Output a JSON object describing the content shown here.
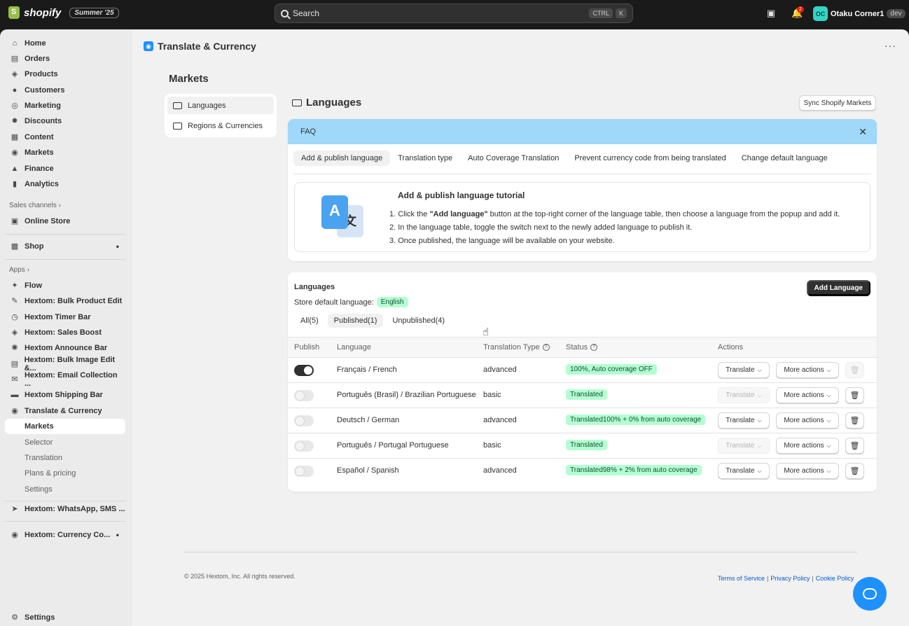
{
  "topbar": {
    "brand": "shopify",
    "edition_badge": "Summer '25",
    "search_placeholder": "Search",
    "shortcut_keys": [
      "CTRL",
      "K"
    ],
    "notification_count": "2",
    "user_initials": "OC",
    "store_name": "Otaku Corner1",
    "env_badge": "dev"
  },
  "sidebar": {
    "main_items": [
      {
        "label": "Home",
        "icon": "home-icon"
      },
      {
        "label": "Orders",
        "icon": "inbox-icon"
      },
      {
        "label": "Products",
        "icon": "tag-icon"
      },
      {
        "label": "Customers",
        "icon": "person-icon"
      },
      {
        "label": "Marketing",
        "icon": "target-icon"
      },
      {
        "label": "Discounts",
        "icon": "discount-icon"
      },
      {
        "label": "Content",
        "icon": "content-icon"
      },
      {
        "label": "Markets",
        "icon": "globe-icon"
      },
      {
        "label": "Finance",
        "icon": "bank-icon"
      },
      {
        "label": "Analytics",
        "icon": "chart-icon"
      }
    ],
    "sales_channels_label": "Sales channels",
    "online_store": "Online Store",
    "shop": "Shop",
    "apps_label": "Apps",
    "apps": [
      "Flow",
      "Hextom: Bulk Product Edit",
      "Hextom Timer Bar",
      "Hextom: Sales Boost",
      "Hextom Announce Bar",
      "Hextom: Bulk Image Edit &...",
      "Hextom: Email Collection ...",
      "Hextom Shipping Bar",
      "Translate & Currency"
    ],
    "app_subitems": [
      "Markets",
      "Selector",
      "Translation",
      "Plans & pricing",
      "Settings"
    ],
    "extra_apps": [
      "Hextom: WhatsApp, SMS ...",
      "Hextom: Currency Co..."
    ],
    "settings": "Settings"
  },
  "app": {
    "title": "Translate & Currency",
    "page_title": "Markets",
    "subnav": [
      "Languages",
      "Regions & Currencies"
    ]
  },
  "languages_section": {
    "title": "Languages",
    "sync_button": "Sync Shopify Markets"
  },
  "faq": {
    "title": "FAQ",
    "tabs": [
      "Add & publish language",
      "Translation type",
      "Auto Coverage Translation",
      "Prevent currency code from being translated",
      "Change default language"
    ],
    "tutorial_title": "Add & publish language tutorial",
    "illus_letter_a": "A",
    "illus_letter_x": "文",
    "step1_prefix": "1. Click the ",
    "step1_bold": "\"Add language\"",
    "step1_suffix": " button at the top-right corner of the language table, then choose a language from the popup and add it.",
    "step2": "2. In the language table, toggle the switch next to the newly added language to publish it.",
    "step3": "3. Once published, the language will be available on your website."
  },
  "languages_card": {
    "title": "Languages",
    "default_label": "Store default language:",
    "default_value": "English",
    "add_button": "Add Language",
    "filters": [
      "All(5)",
      "Published(1)",
      "Unpublished(4)"
    ],
    "columns": {
      "publish": "Publish",
      "language": "Language",
      "translation_type": "Translation Type",
      "status": "Status",
      "actions": "Actions"
    },
    "translate_label": "Translate",
    "more_actions_label": "More actions",
    "rows": [
      {
        "published": true,
        "language": "Français / French",
        "type": "advanced",
        "status": "100%, Auto coverage OFF",
        "translate_enabled": true,
        "delete_enabled": false
      },
      {
        "published": false,
        "language": "Português (Brasil) / Brazilian Portuguese",
        "type": "basic",
        "status": "Translated",
        "translate_enabled": false,
        "delete_enabled": true
      },
      {
        "published": false,
        "language": "Deutsch / German",
        "type": "advanced",
        "status": "Translated100% + 0% from auto coverage",
        "translate_enabled": true,
        "delete_enabled": true
      },
      {
        "published": false,
        "language": "Português / Portugal Portuguese",
        "type": "basic",
        "status": "Translated",
        "translate_enabled": false,
        "delete_enabled": true
      },
      {
        "published": false,
        "language": "Español / Spanish",
        "type": "advanced",
        "status": "Translated98% + 2% from auto coverage",
        "translate_enabled": true,
        "delete_enabled": true
      }
    ]
  },
  "footer": {
    "copyright": "© 2025 Hextom, Inc. All rights reserved.",
    "links": [
      "Terms of Service",
      "Privacy Policy",
      "Cookie Policy"
    ]
  }
}
